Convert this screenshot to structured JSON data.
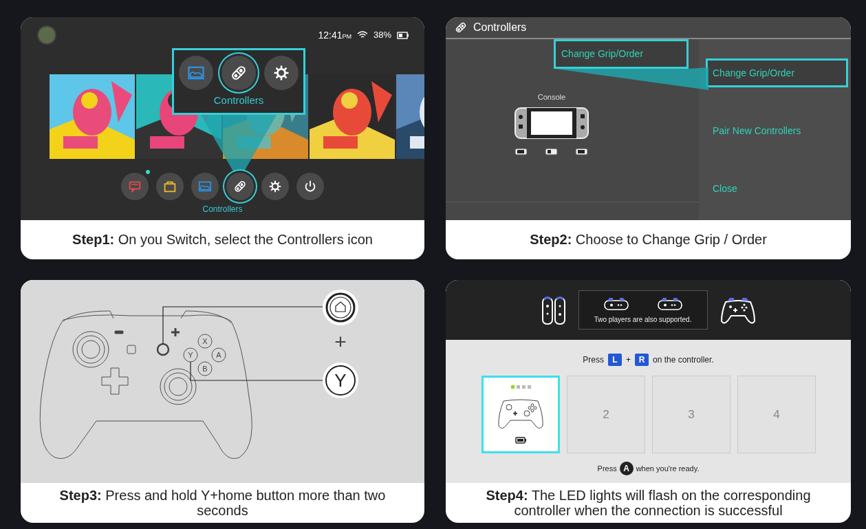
{
  "steps": [
    {
      "kind": "home_menu",
      "status": {
        "time": "12:41",
        "meridiem": "PM",
        "battery": "38%"
      },
      "popup": {
        "label": "Controllers",
        "icons": [
          {
            "kind": "album",
            "selected": false
          },
          {
            "kind": "controllers",
            "selected": true
          },
          {
            "kind": "settings",
            "selected": false
          }
        ]
      },
      "dock": {
        "label": "Controllers",
        "items": [
          {
            "kind": "news",
            "selected": false,
            "notification": true
          },
          {
            "kind": "shop",
            "selected": false,
            "notification": false
          },
          {
            "kind": "album",
            "selected": false,
            "notification": false
          },
          {
            "kind": "controllers",
            "selected": true,
            "notification": false
          },
          {
            "kind": "settings",
            "selected": false,
            "notification": false
          },
          {
            "kind": "power",
            "selected": false,
            "notification": false
          }
        ]
      },
      "caption": "**Step1:** On you Switch, select the Controllers icon"
    },
    {
      "kind": "controllers_menu",
      "title": "Controllers",
      "callout": "Change Grip/Order",
      "console_label": "Console",
      "menu": [
        {
          "label": "Change Grip/Order",
          "selected": true
        },
        {
          "label": "Pair New Controllers",
          "selected": false
        },
        {
          "label": "Close",
          "selected": false
        }
      ],
      "caption": "**Step2:** Choose to Change Grip / Order"
    },
    {
      "kind": "controller_diagram",
      "face_buttons": [
        "X",
        "Y",
        "A",
        "B"
      ],
      "join": "+",
      "button": "Y",
      "caption": "**Step3:** Press and hold Y+home button more than two seconds"
    },
    {
      "kind": "grip_order",
      "tooltip": "Two players are also supported.",
      "prompt": {
        "before": "Press",
        "key_1": "L",
        "join": "+",
        "key_2": "R",
        "after": "on the controller."
      },
      "slots": [
        {
          "kind": "controller",
          "selected": true,
          "leds": [
            true,
            false,
            false,
            false
          ]
        },
        {
          "kind": "empty",
          "label": "2",
          "selected": false
        },
        {
          "kind": "empty",
          "label": "3",
          "selected": false
        },
        {
          "kind": "empty",
          "label": "4",
          "selected": false
        }
      ],
      "confirm": {
        "before": "Press",
        "key": "A",
        "after": "when you're ready."
      },
      "caption": "**Step4:** The LED lights will flash on the corresponding controller when the connection is successful"
    }
  ]
}
